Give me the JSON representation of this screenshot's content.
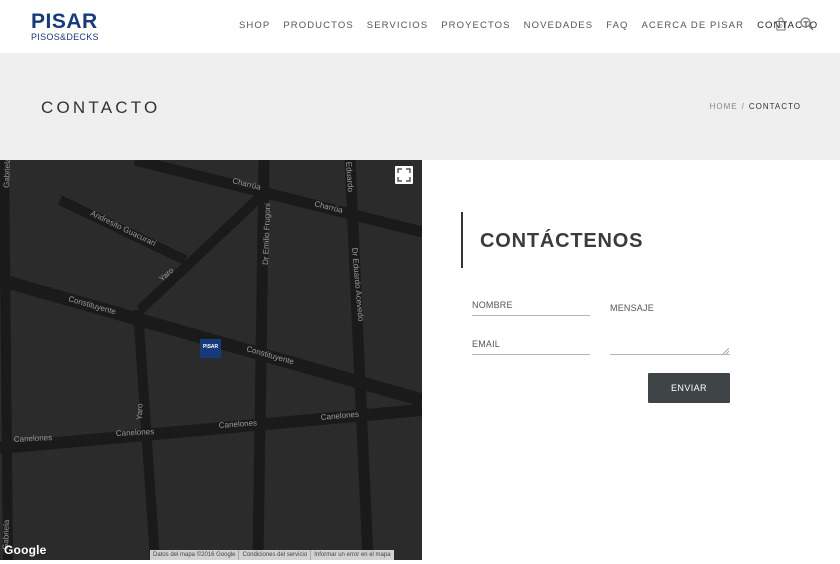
{
  "header": {
    "logo": {
      "main": "PISAR",
      "sub": "PISOS&DECKS"
    },
    "nav": [
      {
        "label": "SHOP"
      },
      {
        "label": "PRODUCTOS"
      },
      {
        "label": "SERVICIOS"
      },
      {
        "label": "PROYECTOS"
      },
      {
        "label": "NOVEDADES"
      },
      {
        "label": "FAQ"
      },
      {
        "label": "ACERCA DE PISAR"
      },
      {
        "label": "CONTACTO",
        "active": true
      }
    ],
    "icons": [
      "shopping-bag-icon",
      "search-icon"
    ]
  },
  "title_band": {
    "title": "CONTACTO",
    "breadcrumb": {
      "home": "HOME",
      "separator": "/",
      "current": "CONTACTO"
    }
  },
  "map": {
    "streets": {
      "gabriela_top": "Gabriela",
      "charrua_1": "Charrúa",
      "charrua_2": "Charrúa",
      "gurruchaga": "Andresito Guacurarí",
      "yaro_1": "Yaro",
      "fruyini": "Dr Emilio Frugoni",
      "acevedo": "Dr Eduardo Acevedo",
      "constituyente_1": "Constituyente",
      "constituyente_2": "Constituyente",
      "yaro_2": "Yaro",
      "canelones_1": "Canelones",
      "canelones_2": "Canelones",
      "canelones_3": "Canelones",
      "canelones_4": "Canelones",
      "gabriela_bottom": "Gabriela",
      "eduardo_top": "Eduardo"
    },
    "marker_label": "PISAR",
    "google_logo": "Google",
    "footer": [
      "Datos del mapa ©2016 Google",
      "Condiciones del servicio",
      "Informar un error en el mapa"
    ]
  },
  "contact": {
    "title": "CONTÁCTENOS",
    "fields": {
      "nombre_placeholder": "NOMBRE",
      "email_placeholder": "EMAIL",
      "mensaje_placeholder": "MENSAJE"
    },
    "submit_label": "ENVIAR"
  },
  "colors": {
    "brand": "#173a7a",
    "title_band_bg": "#efefef",
    "map_bg": "#2b2b2b",
    "map_road": "#1a1a1a",
    "button_bg": "#3f4547"
  }
}
